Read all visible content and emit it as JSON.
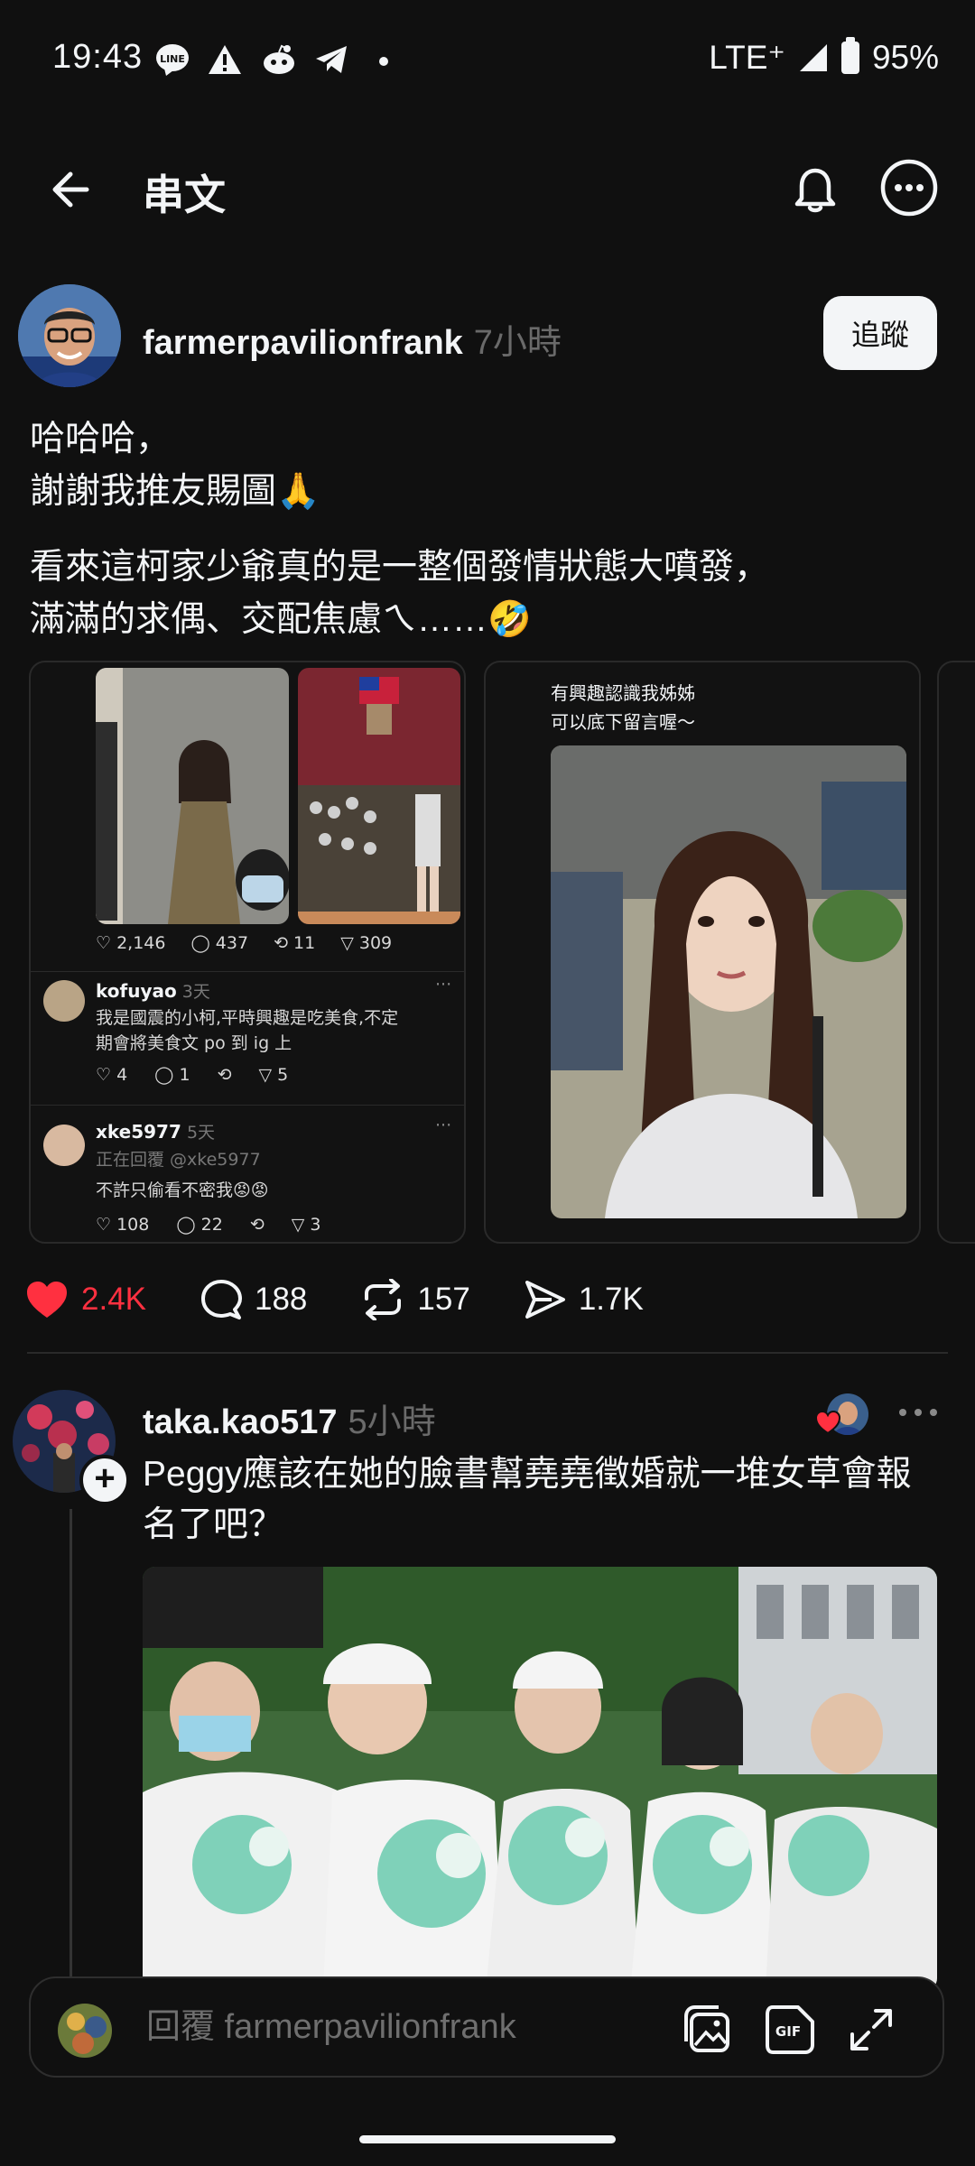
{
  "status_bar": {
    "time": "19:43",
    "network": "LTE⁺",
    "battery": "95%",
    "icons": [
      "line-icon",
      "warning-icon",
      "reddit-icon",
      "telegram-icon",
      "dot-icon",
      "signal-icon",
      "battery-icon"
    ]
  },
  "header": {
    "title": "串文"
  },
  "post": {
    "username": "farmerpavilionfrank",
    "time_ago": "7小時",
    "follow_label": "追蹤",
    "text1": "哈哈哈，\n謝謝我推友賜圖🙏",
    "text2": "看來這柯家少爺真的是一整個發情狀態大噴發，\n滿滿的求偶、交配焦慮ㄟ……🤣",
    "media": {
      "card1": {
        "stats": {
          "likes": "2,146",
          "comments": "437",
          "reposts": "11",
          "shares": "309"
        },
        "comments": [
          {
            "user": "kofuyao",
            "time": "3天",
            "text": "我是國震的小柯,平時興趣是吃美食,不定\n期會將美食文 po 到 ig 上",
            "likes": "4",
            "replies": "1",
            "shares": "5"
          },
          {
            "user": "xke5977",
            "time": "5天",
            "reply_to": "正在回覆 @xke5977",
            "text": "不許只偷看不密我😡😡",
            "likes": "108",
            "replies": "22",
            "shares": "3"
          }
        ]
      },
      "card2": {
        "caption": "有興趣認識我姊姊\n可以底下留言喔～"
      }
    },
    "actions": {
      "likes": "2.4K",
      "comments": "188",
      "reposts": "157",
      "shares": "1.7K"
    },
    "colors": {
      "like": "#ff3040"
    }
  },
  "reply_post": {
    "username": "taka.kao517",
    "time_ago": "5小時",
    "text": "Peggy應該在她的臉書幫堯堯徵婚就一堆女草會報名了吧？"
  },
  "reply_bar": {
    "placeholder": "回覆 farmerpavilionfrank"
  }
}
